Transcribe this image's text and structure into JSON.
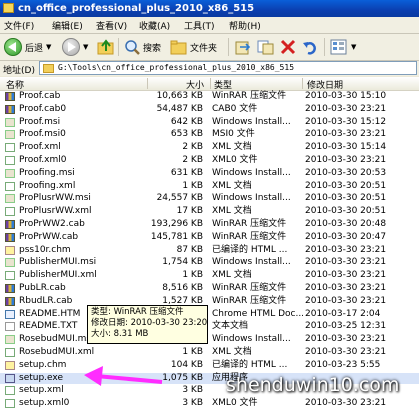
{
  "window": {
    "title": "cn_office_professional_plus_2010_x86_515"
  },
  "menu": [
    "文件(F)",
    "编辑(E)",
    "查看(V)",
    "收藏(A)",
    "工具(T)",
    "帮助(H)"
  ],
  "toolbar": {
    "back": "后退",
    "search": "搜索",
    "folders": "文件夹"
  },
  "address": {
    "label": "地址(D)",
    "path": "G:\\Tools\\cn_office_professional_plus_2010_x86_515"
  },
  "columns": {
    "name": "名称",
    "size": "大小",
    "type": "类型",
    "date": "修改日期"
  },
  "files": [
    {
      "name": "Proof.cab",
      "size": "10,663 KB",
      "type": "WinRAR 压缩文件",
      "date": "2010-03-30 15:10",
      "icon": "cab"
    },
    {
      "name": "Proof.cab0",
      "size": "54,487 KB",
      "type": "CAB0 文件",
      "date": "2010-03-30 23:21",
      "icon": "cab"
    },
    {
      "name": "Proof.msi",
      "size": "642 KB",
      "type": "Windows Install...",
      "date": "2010-03-30 15:12",
      "icon": "msi"
    },
    {
      "name": "Proof.msi0",
      "size": "653 KB",
      "type": "MSI0 文件",
      "date": "2010-03-30 23:21",
      "icon": "msi"
    },
    {
      "name": "Proof.xml",
      "size": "2 KB",
      "type": "XML 文档",
      "date": "2010-03-30 15:14",
      "icon": "xml"
    },
    {
      "name": "Proof.xml0",
      "size": "2 KB",
      "type": "XML0 文件",
      "date": "2010-03-30 23:21",
      "icon": "xml"
    },
    {
      "name": "Proofing.msi",
      "size": "631 KB",
      "type": "Windows Install...",
      "date": "2010-03-30 20:53",
      "icon": "msi"
    },
    {
      "name": "Proofing.xml",
      "size": "1 KB",
      "type": "XML 文档",
      "date": "2010-03-30 20:51",
      "icon": "xml"
    },
    {
      "name": "ProPlusrWW.msi",
      "size": "24,557 KB",
      "type": "Windows Install...",
      "date": "2010-03-30 20:51",
      "icon": "msi"
    },
    {
      "name": "ProPlusrWW.xml",
      "size": "17 KB",
      "type": "XML 文档",
      "date": "2010-03-30 20:51",
      "icon": "xml"
    },
    {
      "name": "ProPrWW2.cab",
      "size": "193,296 KB",
      "type": "WinRAR 压缩文件",
      "date": "2010-03-30 20:48",
      "icon": "cab"
    },
    {
      "name": "ProPrWW.cab",
      "size": "145,781 KB",
      "type": "WinRAR 压缩文件",
      "date": "2010-03-30 20:47",
      "icon": "cab"
    },
    {
      "name": "pss10r.chm",
      "size": "87 KB",
      "type": "已编译的 HTML ...",
      "date": "2010-03-30 23:21",
      "icon": "chm"
    },
    {
      "name": "PublisherMUI.msi",
      "size": "1,754 KB",
      "type": "Windows Install...",
      "date": "2010-03-30 23:21",
      "icon": "msi"
    },
    {
      "name": "PublisherMUI.xml",
      "size": "1 KB",
      "type": "XML 文档",
      "date": "2010-03-30 23:21",
      "icon": "xml"
    },
    {
      "name": "PubLR.cab",
      "size": "8,516 KB",
      "type": "WinRAR 压缩文件",
      "date": "2010-03-30 23:21",
      "icon": "cab"
    },
    {
      "name": "RbudLR.cab",
      "size": "1,527 KB",
      "type": "WinRAR 压缩文件",
      "date": "2010-03-30 23:21",
      "icon": "cab"
    },
    {
      "name": "README.HTM",
      "size": "",
      "type": "Chrome HTML Doc...",
      "date": "2010-03-17 2:04",
      "icon": "htm"
    },
    {
      "name": "README.TXT",
      "size": "",
      "type": "文本文档",
      "date": "2010-03-25 12:31",
      "icon": "txt"
    },
    {
      "name": "RosebudMUI.msi",
      "size": "",
      "type": "Windows Install...",
      "date": "2010-03-30 23:21",
      "icon": "msi"
    },
    {
      "name": "RosebudMUI.xml",
      "size": "1 KB",
      "type": "XML 文档",
      "date": "2010-03-30 23:21",
      "icon": "xml"
    },
    {
      "name": "setup.chm",
      "size": "104 KB",
      "type": "已编译的 HTML ...",
      "date": "2010-03-23 5:55",
      "icon": "chm"
    },
    {
      "name": "setup.exe",
      "size": "1,075 KB",
      "type": "应用程序",
      "date": "",
      "icon": "exe",
      "selected": true
    },
    {
      "name": "setup.xml",
      "size": "3 KB",
      "type": "",
      "date": "",
      "icon": "xml"
    },
    {
      "name": "setup.xml0",
      "size": "3 KB",
      "type": "XML0 文件",
      "date": "2010-03-30 23:21",
      "icon": "xml"
    }
  ],
  "tooltip": {
    "type": "类型: WinRAR 压缩文件",
    "modified": "修改日期: 2010-03-30 23:20",
    "size": "大小: 8.31 MB"
  },
  "watermark": "shenduwin10.com",
  "colors": {
    "titlebar": "#0b3fb0",
    "arrow": "#ff2cff",
    "tooltip_bg": "#ffffe1"
  }
}
